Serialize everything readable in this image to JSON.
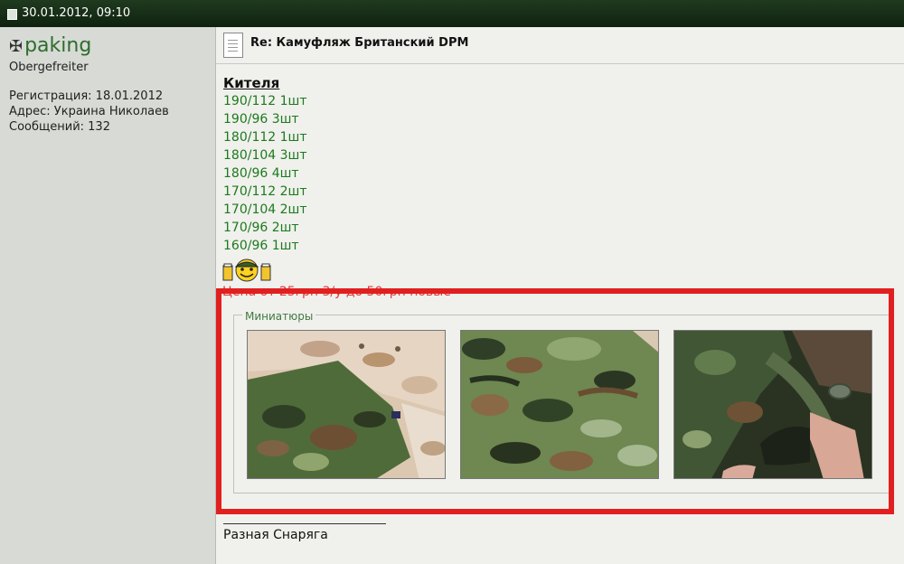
{
  "post": {
    "datetime": "30.01.2012, 09:10",
    "title": "Re: Камуфляж Британский DPM",
    "section_heading": "Кителя",
    "sizes": [
      "190/112 1шт",
      "190/96 3шт",
      "180/112 1шт",
      "180/104 3шт",
      "180/96 4шт",
      "170/112 2шт",
      "170/104 2шт",
      "170/96 2шт",
      "160/96 1шт"
    ],
    "price_text": "Цена от 25грн 3/у до 50грн новые",
    "thumbnails_legend": "Миниатюры",
    "thumbnails": [
      "camo-thumbnail-1",
      "camo-thumbnail-2",
      "camo-thumbnail-3"
    ],
    "footer_text": "Разная Снаряга"
  },
  "author": {
    "username": "paking",
    "rank": "Obergefreiter",
    "registration": "Регистрация: 18.01.2012",
    "address": "Адрес: Украина Николаев",
    "messages": "Сообщений: 132"
  },
  "colors": {
    "username": "#2d6d2d",
    "sizes": "#1c7a1c",
    "price": "#e03a3a",
    "highlight": "#e11f1f",
    "topbar": "#1f3a1f"
  }
}
